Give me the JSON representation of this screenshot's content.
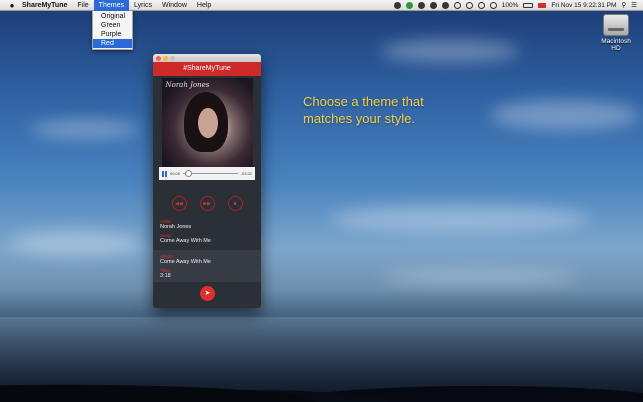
{
  "menubar": {
    "app_name": "ShareMyTune",
    "menus": [
      "File",
      "Themes",
      "Lyrics",
      "Window",
      "Help"
    ],
    "status": {
      "battery": "100%",
      "datetime": "Fri Nov 15  9:22:31 PM"
    }
  },
  "themes_menu": {
    "options": [
      "Original",
      "Green",
      "Purple",
      "Red"
    ],
    "selected": "Red"
  },
  "desktop": {
    "disk_label": "Macintosh HD",
    "tagline_line1": "Choose a theme that",
    "tagline_line2": "matches your style."
  },
  "app": {
    "header": "#ShareMyTune",
    "album_signature": "Norah Jones",
    "player": {
      "elapsed": "00:06",
      "remaining": "-03:32",
      "progress": 0.03
    },
    "fields": {
      "artist_label": "Artist:",
      "artist_value": "Norah Jones",
      "song_label": "Song:",
      "song_value": "Come Away With Me",
      "album_label": "Album:",
      "album_value": "Come Away With Me",
      "time_label": "Time:",
      "time_value": "3:18"
    },
    "theme_color": "#cf2a2a"
  }
}
